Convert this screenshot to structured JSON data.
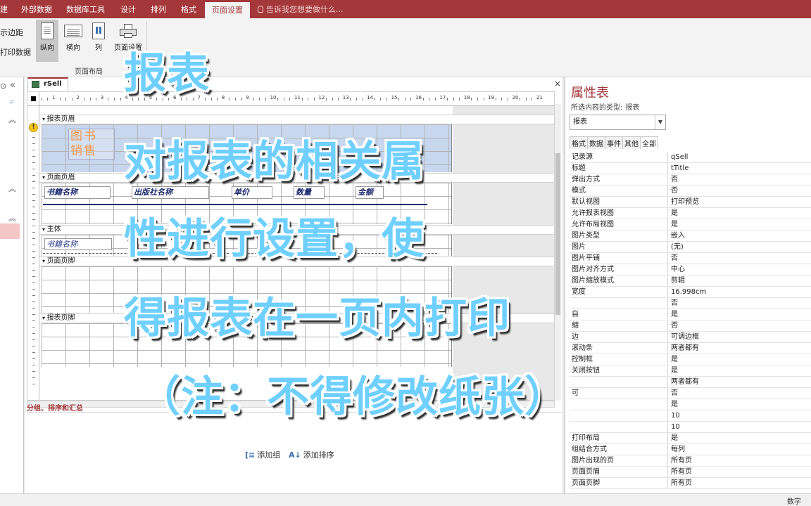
{
  "ribbon": {
    "tabs": [
      "建",
      "外部数据",
      "数据库工具",
      "设计",
      "排列",
      "格式",
      "页面设置"
    ],
    "active_tab": "页面设置",
    "tell_me": "告诉我您想要做什么...",
    "left_items": [
      "示边距",
      "打印数据"
    ],
    "buttons": {
      "portrait": "纵向",
      "landscape": "横向",
      "columns": "列",
      "page_setup": "页面设置"
    },
    "group_label": "页面布局"
  },
  "document": {
    "tab_title": "rSell",
    "close": "×",
    "ruler_numbers": [
      "1",
      "2",
      "3",
      "4",
      "5",
      "6",
      "7",
      "8",
      "9",
      "10",
      "11",
      "12",
      "13",
      "14",
      "15",
      "16",
      "17",
      "18",
      "19",
      "20",
      "21"
    ],
    "sections": {
      "report_header": "报表页眉",
      "page_header": "页面页眉",
      "detail": "主体",
      "page_footer": "页面页脚",
      "report_footer": "报表页脚"
    },
    "report_title_lines": [
      "图书",
      "销售"
    ],
    "header_labels": [
      "书籍名称",
      "出版社名称",
      "单价",
      "数量",
      "金额"
    ],
    "detail_field": "书籍名称",
    "group_pane_title": "分组、排序和汇总",
    "add_group": "添加组",
    "add_sort": "添加排序"
  },
  "property_sheet": {
    "title": "属性表",
    "type_label": "所选内容的类型:",
    "type_value": "报表",
    "selector": "报表",
    "tabs": [
      "格式",
      "数据",
      "事件",
      "其他",
      "全部"
    ],
    "active_tab": "全部",
    "rows": [
      {
        "k": "记录源",
        "v": "qSell"
      },
      {
        "k": "标题",
        "v": "tTitle"
      },
      {
        "k": "弹出方式",
        "v": "否"
      },
      {
        "k": "模式",
        "v": "否"
      },
      {
        "k": "默认视图",
        "v": "打印预览"
      },
      {
        "k": "允许报表视图",
        "v": "是"
      },
      {
        "k": "允许布局视图",
        "v": "是"
      },
      {
        "k": "图片类型",
        "v": "嵌入"
      },
      {
        "k": "图片",
        "v": "(无)"
      },
      {
        "k": "图片平铺",
        "v": "否"
      },
      {
        "k": "图片对齐方式",
        "v": "中心"
      },
      {
        "k": "图片缩放模式",
        "v": "剪辑"
      },
      {
        "k": "宽度",
        "v": "16.998cm"
      },
      {
        "k": "",
        "v": "否"
      },
      {
        "k": "自",
        "v": "是"
      },
      {
        "k": "缩",
        "v": "否"
      },
      {
        "k": "边",
        "v": "可调边框"
      },
      {
        "k": "滚动条",
        "v": "两者都有"
      },
      {
        "k": "控制框",
        "v": "是"
      },
      {
        "k": "关闭按钮",
        "v": "是"
      },
      {
        "k": "",
        "v": "两者都有"
      },
      {
        "k": "可",
        "v": "否"
      },
      {
        "k": "",
        "v": "是"
      },
      {
        "k": "",
        "v": "10"
      },
      {
        "k": "",
        "v": "10"
      },
      {
        "k": "打印布局",
        "v": "是"
      },
      {
        "k": "组结合方式",
        "v": "每列"
      },
      {
        "k": "图片出现的页",
        "v": "所有页"
      },
      {
        "k": "页面页眉",
        "v": "所有页"
      },
      {
        "k": "页面页脚",
        "v": "所有页"
      }
    ]
  },
  "status": {
    "right": "数字"
  },
  "overlay": {
    "lines": [
      "报表",
      "对报表的相关属",
      "性进行设置，使",
      "得报表在一页内打印",
      "（注：不得修改纸张）"
    ]
  },
  "colors": {
    "accent": "#a4373a",
    "overlay_text": "#6fd0ff",
    "header_blue": "#c7d7ee"
  }
}
